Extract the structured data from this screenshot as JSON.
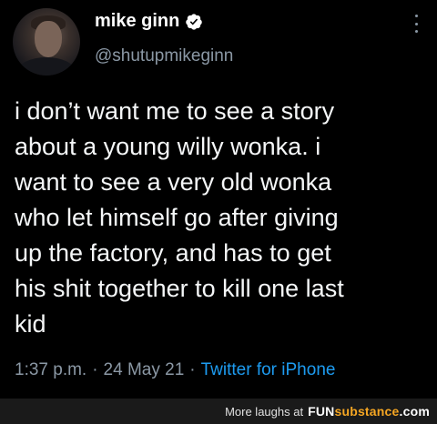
{
  "tweet": {
    "author": {
      "name": "mike ginn",
      "handle": "@shutupmikeginn",
      "verified": true
    },
    "text": "i don’t want me to see a story\nabout a young willy wonka. i\nwant to see a very old wonka\nwho let himself go after giving\nup the factory, and has to get\nhis shit together to kill one last\nkid",
    "time": "1:37 p.m.",
    "separator": "·",
    "date": "24 May 21",
    "source": "Twitter for iPhone"
  },
  "footer": {
    "tagline": "More laughs at",
    "brand_main": "FUN",
    "brand_accent": "substance",
    "brand_suffix": ".com"
  },
  "colors": {
    "background": "#000000",
    "text": "#f5f7f8",
    "muted": "#8b98a5",
    "link": "#1d9bf0",
    "verified": "#1d9bf0",
    "footer_bg": "#1a1a1a",
    "brand_accent": "#f5a623"
  },
  "icons": {
    "verified": "verified-badge-icon",
    "more": "more-options-icon"
  }
}
